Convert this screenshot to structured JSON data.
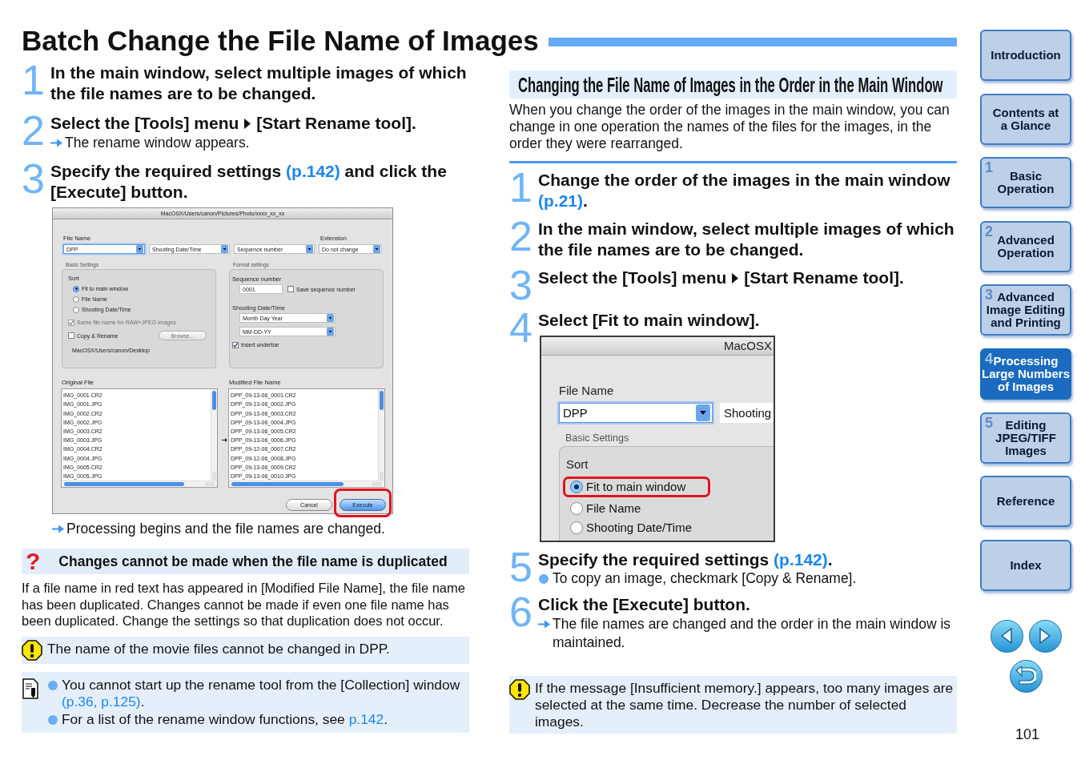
{
  "title": "Batch Change the File Name of Images",
  "left": {
    "steps": [
      {
        "number": "1",
        "heading": [
          {
            "kind": "text",
            "text": "In the main window, select multiple images of which the file names are to be changed."
          }
        ]
      },
      {
        "number": "2",
        "heading": [
          {
            "kind": "text",
            "text": "Select the [Tools] menu"
          },
          {
            "kind": "arrow"
          },
          {
            "kind": "text",
            "text": "[Start Rename tool]."
          }
        ],
        "notes": [
          {
            "kind": "result",
            "text": "The rename window appears."
          }
        ]
      },
      {
        "number": "3",
        "heading": [
          {
            "kind": "text",
            "text": "Specify the required settings "
          },
          {
            "kind": "link",
            "text": "(p.142)"
          },
          {
            "kind": "text",
            "text": " and click the [Execute] button."
          }
        ],
        "figure": {
          "kind": "full",
          "title": "MacOSX/Users/canon/Pictures/Photo/xxxx_xx_xx",
          "file_name_label": "File Name",
          "extension_label": "Extension",
          "name_fields": [
            {
              "value": "DPP",
              "focused": true
            },
            {
              "value": "Shooting Date/Time",
              "focused": false
            },
            {
              "value": "Sequence number",
              "focused": false
            },
            {
              "value": "Do not change",
              "focused": false
            }
          ],
          "basic": {
            "legend": "Basic Settings",
            "sort_label": "Sort",
            "sort_options": [
              {
                "label": "Fit to main window",
                "selected": true
              },
              {
                "label": "File Name",
                "selected": false
              },
              {
                "label": "Shooting Date/Time",
                "selected": false
              }
            ],
            "checkboxes": [
              {
                "label": "Same file name for RAW+JPEG images",
                "checked": true,
                "disabled": true
              },
              {
                "label": "Copy & Rename",
                "checked": false,
                "disabled": false,
                "button": {
                  "label": "Browse...",
                  "disabled": true
                }
              }
            ],
            "path": "MacOSX/Users/canon/Desktop"
          },
          "format": {
            "legend": "Format settings",
            "sequence_label": "Sequence number",
            "sequence_value": "0001",
            "save_sequence": {
              "label": "Save sequence number",
              "checked": false
            },
            "date_label": "Shooting Date/Time",
            "date_fields": [
              "Month Day Year",
              "MM-DD-YY"
            ],
            "underbar": {
              "label": "Insert underbar",
              "checked": true
            }
          },
          "original": {
            "label": "Original File",
            "files": [
              "IMG_0001.CR2",
              "IMG_0001.JPG",
              "IMG_0002.CR2",
              "IMG_0002.JPG",
              "IMG_0003.CR2",
              "IMG_0003.JPG",
              "IMG_0004.CR2",
              "IMG_0004.JPG",
              "IMG_0005.CR2",
              "IMG_0005.JPG"
            ]
          },
          "modified": {
            "label": "Modified File Name",
            "files": [
              {
                "name": "DPP_09-13-06_0001.CR2",
                "arrow": false
              },
              {
                "name": "DPP_09-13-06_0002.JPG",
                "arrow": false
              },
              {
                "name": "DPP_09-13-06_0003.CR2",
                "arrow": false
              },
              {
                "name": "DPP_09-13-06_0004.JPG",
                "arrow": false
              },
              {
                "name": "DPP_09-13-06_0005.CR2",
                "arrow": false
              },
              {
                "name": "DPP_09-13-06_0006.JPG",
                "arrow": true
              },
              {
                "name": "DPP_09-12-06_0007.CR2",
                "arrow": false
              },
              {
                "name": "DPP_09-12-06_0008.JPG",
                "arrow": false
              },
              {
                "name": "DPP_09-13-06_0009.CR2",
                "arrow": false
              },
              {
                "name": "DPP_09-13-06_0010.JPG",
                "arrow": false
              }
            ]
          },
          "buttons": [
            {
              "label": "Cancel",
              "default": false,
              "highlighted": false
            },
            {
              "label": "Execute",
              "default": true,
              "highlighted": true
            }
          ]
        },
        "notes": [
          {
            "kind": "result",
            "text": "Processing begins and the file names are changed."
          }
        ]
      }
    ],
    "caution": {
      "icon": "?",
      "heading": "Changes cannot be made when the file name is duplicated",
      "body": "If a file name in red text has appeared in [Modified File Name], the file name has been duplicated. Changes cannot be made if even one file name has been duplicated. Change the settings so that duplication does not occur."
    },
    "notes": [
      {
        "kind": "warning",
        "items": [
          [
            {
              "kind": "text",
              "text": "The name of the movie files cannot be changed in DPP."
            }
          ]
        ]
      },
      {
        "kind": "memo",
        "items": [
          [
            {
              "kind": "text",
              "text": "You cannot start up the rename tool from the [Collection] window "
            },
            {
              "kind": "link",
              "text": "(p.36, p.125)"
            },
            {
              "kind": "text",
              "text": "."
            }
          ],
          [
            {
              "kind": "text",
              "text": "For a list of the rename window functions, see "
            },
            {
              "kind": "link",
              "text": "p.142"
            },
            {
              "kind": "text",
              "text": "."
            }
          ]
        ]
      }
    ]
  },
  "right": {
    "heading": "Changing the File Name of Images in the Order in the Main Window",
    "intro": "When you change the order of the images in the main window, you can change in one operation the names of the files for the images, in the order they were rearranged.",
    "steps": [
      {
        "number": "1",
        "heading": [
          {
            "kind": "text",
            "text": "Change the order of the images in the main window "
          },
          {
            "kind": "link",
            "text": "(p.21)"
          },
          {
            "kind": "text",
            "text": "."
          }
        ]
      },
      {
        "number": "2",
        "heading": [
          {
            "kind": "text",
            "text": "In the main window, select multiple images of which the file names are to be changed."
          }
        ]
      },
      {
        "number": "3",
        "heading": [
          {
            "kind": "text",
            "text": "Select the [Tools] menu"
          },
          {
            "kind": "arrow"
          },
          {
            "kind": "text",
            "text": "[Start Rename tool]."
          }
        ]
      },
      {
        "number": "4",
        "heading": [
          {
            "kind": "text",
            "text": "Select [Fit to main window]."
          }
        ],
        "figure": {
          "kind": "detail",
          "title": "MacOSX",
          "file_name_label": "File Name",
          "name_fields": [
            {
              "value": "DPP",
              "focused": true,
              "arrow": true
            },
            {
              "value": "Shooting",
              "focused": false,
              "arrow": false
            }
          ],
          "legend": "Basic Settings",
          "sort_label": "Sort",
          "sort_options": [
            {
              "label": "Fit to main window",
              "selected": true,
              "highlighted": true
            },
            {
              "label": "File Name",
              "selected": false,
              "highlighted": false
            },
            {
              "label": "Shooting Date/Time",
              "selected": false,
              "highlighted": false
            }
          ]
        }
      },
      {
        "number": "5",
        "heading": [
          {
            "kind": "text",
            "text": "Specify the required settings "
          },
          {
            "kind": "link",
            "text": "(p.142)"
          },
          {
            "kind": "text",
            "text": "."
          }
        ],
        "notes": [
          {
            "kind": "bullet",
            "text": "To copy an image, checkmark [Copy & Rename]."
          }
        ]
      },
      {
        "number": "6",
        "heading": [
          {
            "kind": "text",
            "text": "Click the [Execute] button."
          }
        ],
        "notes": [
          {
            "kind": "result",
            "text": "The file names are changed and the order in the main window is maintained."
          }
        ]
      }
    ],
    "notes": [
      {
        "kind": "warning",
        "items": [
          [
            {
              "kind": "text",
              "text": "If the message [Insufficient memory.] appears, too many images are selected at the same time. Decrease the number of selected images."
            }
          ]
        ]
      }
    ]
  },
  "nav": [
    {
      "lines": [
        "Introduction"
      ],
      "selected": false
    },
    {
      "lines": [
        "Contents at",
        "a Glance"
      ],
      "selected": false
    },
    {
      "lines": [
        "Basic",
        "Operation"
      ],
      "chapter": "1",
      "selected": false
    },
    {
      "lines": [
        "Advanced",
        "Operation"
      ],
      "chapter": "2",
      "selected": false
    },
    {
      "lines": [
        "Advanced",
        "Image Editing",
        "and Printing"
      ],
      "chapter": "3",
      "selected": false
    },
    {
      "lines": [
        "Processing",
        "Large Numbers",
        "of Images"
      ],
      "chapter": "4",
      "selected": true
    },
    {
      "lines": [
        "Editing",
        "JPEG/TIFF",
        "Images"
      ],
      "chapter": "5",
      "selected": false
    },
    {
      "lines": [
        "Reference"
      ],
      "selected": false
    },
    {
      "lines": [
        "Index"
      ],
      "selected": false
    }
  ],
  "page_number": "101"
}
